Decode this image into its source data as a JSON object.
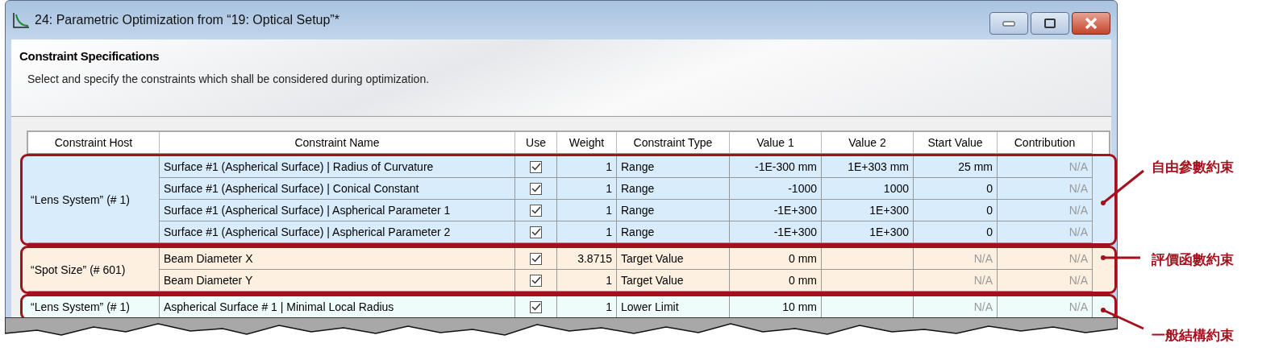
{
  "window": {
    "title": "24: Parametric Optimization from “19: Optical Setup”*"
  },
  "header": {
    "title": "Constraint Specifications",
    "description": "Select and specify the constraints which shall be considered during optimization."
  },
  "table": {
    "columns": [
      "Constraint Host",
      "Constraint Name",
      "Use",
      "Weight",
      "Constraint Type",
      "Value 1",
      "Value 2",
      "Start Value",
      "Contribution"
    ],
    "groups": [
      {
        "host": "“Lens System” (# 1)",
        "color": "#d9ecfc",
        "rows": [
          {
            "name": "Surface #1 (Aspherical Surface) | Radius of Curvature",
            "use": true,
            "weight": "1",
            "type": "Range",
            "value_1": "-1E-300 mm",
            "value_2": "1E+303 mm",
            "start_value": {
              "text": "25 mm",
              "disabled": false
            },
            "contribution": {
              "text": "N/A",
              "disabled": true
            }
          },
          {
            "name": "Surface #1 (Aspherical Surface) | Conical Constant",
            "use": true,
            "weight": "1",
            "type": "Range",
            "value_1": "-1000",
            "value_2": "1000",
            "start_value": {
              "text": "0",
              "disabled": false
            },
            "contribution": {
              "text": "N/A",
              "disabled": true
            }
          },
          {
            "name": "Surface #1 (Aspherical Surface) | Aspherical Parameter 1",
            "use": true,
            "weight": "1",
            "type": "Range",
            "value_1": "-1E+300",
            "value_2": "1E+300",
            "start_value": {
              "text": "0",
              "disabled": false
            },
            "contribution": {
              "text": "N/A",
              "disabled": true
            }
          },
          {
            "name": "Surface #1 (Aspherical Surface) | Aspherical Parameter 2",
            "use": true,
            "weight": "1",
            "type": "Range",
            "value_1": "-1E+300",
            "value_2": "1E+300",
            "start_value": {
              "text": "0",
              "disabled": false
            },
            "contribution": {
              "text": "N/A",
              "disabled": true
            }
          }
        ]
      },
      {
        "host": "“Spot Size” (# 601)",
        "color": "#fdf0e0",
        "rows": [
          {
            "name": "Beam Diameter X",
            "use": true,
            "weight": "3.8715",
            "type": "Target Value",
            "value_1": "0 mm",
            "start_value": {
              "text": "N/A",
              "disabled": true
            },
            "contribution": {
              "text": "N/A",
              "disabled": true
            }
          },
          {
            "name": "Beam Diameter Y",
            "use": true,
            "weight": "1",
            "type": "Target Value",
            "value_1": "0 mm",
            "start_value": {
              "text": "N/A",
              "disabled": true
            },
            "contribution": {
              "text": "N/A",
              "disabled": true
            }
          }
        ]
      },
      {
        "host": "“Lens System” (# 1)",
        "color": "#eefcfa",
        "rows": [
          {
            "name": "Aspherical Surface # 1 | Minimal Local Radius",
            "use": true,
            "weight": "1",
            "type": "Lower Limit",
            "value_1": "10 mm",
            "start_value": {
              "text": "N/A",
              "disabled": true
            },
            "contribution": {
              "text": "N/A",
              "disabled": true
            }
          }
        ]
      }
    ]
  },
  "annotations": [
    {
      "label": "自由參數約束"
    },
    {
      "label": "評價函數約束"
    },
    {
      "label": "一般結構約束"
    }
  ]
}
